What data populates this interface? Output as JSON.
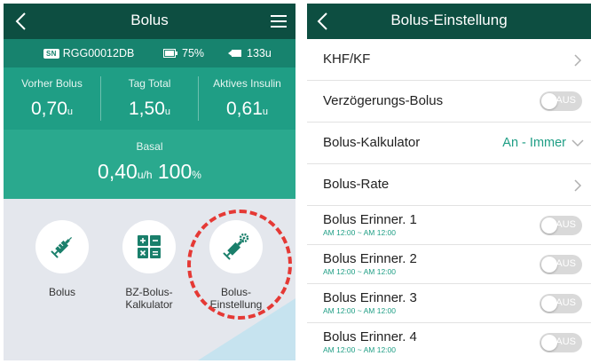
{
  "left_screen": {
    "title": "Bolus",
    "status": {
      "serial": "RGG00012DB",
      "sn_badge": "SN",
      "battery": "75%",
      "insulin": "133u"
    },
    "stats": [
      {
        "label": "Vorher Bolus",
        "value": "0,70",
        "unit": "u"
      },
      {
        "label": "Tag Total",
        "value": "1,50",
        "unit": "u"
      },
      {
        "label": "Aktives Insulin",
        "value": "0,61",
        "unit": "u"
      }
    ],
    "basal": {
      "label": "Basal",
      "value": "0,40",
      "unit": "u/h",
      "percent": "100",
      "percent_unit": "%"
    },
    "actions": [
      {
        "label_line1": "Bolus",
        "label_line2": "",
        "icon": "syringe-icon"
      },
      {
        "label_line1": "BZ-Bolus-",
        "label_line2": "Kalkulator",
        "icon": "calculator-icon"
      },
      {
        "label_line1": "Bolus-",
        "label_line2": "Einstellung",
        "icon": "syringe-gear-icon"
      }
    ],
    "highlighted_action": "Bolus-Einstellung"
  },
  "right_screen": {
    "title": "Bolus-Einstellung",
    "rows": [
      {
        "label": "KHF/KF"
      },
      {
        "label": "Verzögerungs-Bolus",
        "toggle": "AUS"
      },
      {
        "label": "Bolus-Kalkulator",
        "value": "An - Immer"
      },
      {
        "label": "Bolus-Rate"
      },
      {
        "label": "Bolus Erinner. 1",
        "sub": "AM 12:00 ~ AM 12:00",
        "toggle": "AUS"
      },
      {
        "label": "Bolus Erinner. 2",
        "sub": "AM 12:00 ~ AM 12:00",
        "toggle": "AUS"
      },
      {
        "label": "Bolus Erinner. 3",
        "sub": "AM 12:00 ~ AM 12:00",
        "toggle": "AUS"
      },
      {
        "label": "Bolus Erinner. 4",
        "sub": "AM 12:00 ~ AM 12:00",
        "toggle": "AUS"
      }
    ]
  },
  "colors": {
    "header": "#0d4e41",
    "status_bar": "#17836e",
    "stats_bg": "#1f9e85",
    "basal_bg": "#2aa98e",
    "accent": "#1f9e85",
    "highlight": "#e53935",
    "toggle_off": "#d9d9d9"
  }
}
